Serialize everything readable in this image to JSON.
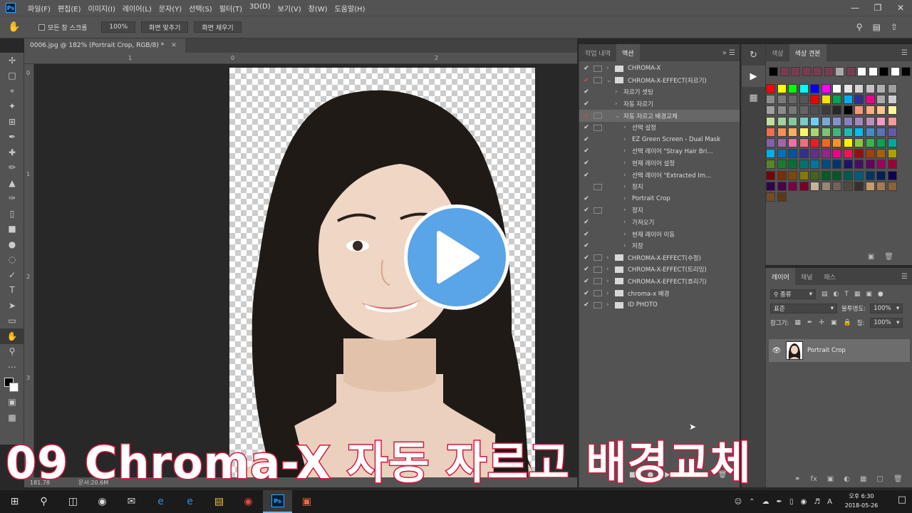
{
  "app": {
    "logo": "Ps"
  },
  "menu": [
    "파일(F)",
    "편집(E)",
    "이미지(I)",
    "레이어(L)",
    "문자(Y)",
    "선택(S)",
    "필터(T)",
    "3D(D)",
    "보기(V)",
    "창(W)",
    "도움말(H)"
  ],
  "options": {
    "scroll_all": "모든 창 스크롤",
    "zoom": "100%",
    "fit_screen": "화면 맞추기",
    "fill_screen": "화면 채우기"
  },
  "document": {
    "tab_title": "0006.jpg @ 182% (Portrait Crop, RGB/8) *",
    "zoom_status": "181.78",
    "doc_status": "문서:20.6M"
  },
  "rulers": {
    "h": [
      "0",
      "1",
      "2"
    ],
    "v": [
      "0",
      "1",
      "2",
      "3"
    ]
  },
  "actions": {
    "tabs": [
      "작업 내역",
      "액션"
    ],
    "rows": [
      {
        "label": "CHROMA-X",
        "checked": true,
        "red": false,
        "dialog": true,
        "depth": 0,
        "folder": true,
        "expanded": false
      },
      {
        "label": "CHROMA-X-EFFECT(자르기)",
        "checked": true,
        "red": true,
        "dialog": true,
        "depth": 0,
        "folder": true,
        "expanded": true
      },
      {
        "label": "자르기 셋팅",
        "checked": true,
        "red": false,
        "dialog": false,
        "depth": 1,
        "folder": false,
        "expanded": false
      },
      {
        "label": "자동 자르기",
        "checked": true,
        "red": false,
        "dialog": false,
        "depth": 1,
        "folder": false,
        "expanded": false
      },
      {
        "label": "자동 자르고 배경교체",
        "checked": true,
        "red": true,
        "dialog": true,
        "depth": 1,
        "folder": false,
        "expanded": true,
        "selected": true
      },
      {
        "label": "선택 설정",
        "checked": true,
        "red": false,
        "dialog": true,
        "depth": 2,
        "folder": false,
        "expanded": false
      },
      {
        "label": "EZ Green Screen - Dual Mask",
        "checked": true,
        "red": false,
        "dialog": false,
        "depth": 2,
        "folder": false,
        "expanded": false
      },
      {
        "label": "선택 레이어 \"Stray Hair Bri...",
        "checked": true,
        "red": false,
        "dialog": false,
        "depth": 2,
        "folder": false,
        "expanded": false
      },
      {
        "label": "현재 레이어 설정",
        "checked": true,
        "red": false,
        "dialog": false,
        "depth": 2,
        "folder": false,
        "expanded": false
      },
      {
        "label": "선택 레이어 \"Extracted Im...",
        "checked": true,
        "red": false,
        "dialog": false,
        "depth": 2,
        "folder": false,
        "expanded": false
      },
      {
        "label": "정지",
        "checked": false,
        "red": false,
        "dialog": true,
        "depth": 2,
        "folder": false,
        "expanded": false
      },
      {
        "label": "Portrait Crop",
        "checked": true,
        "red": false,
        "dialog": false,
        "depth": 2,
        "folder": false,
        "expanded": false
      },
      {
        "label": "정지",
        "checked": true,
        "red": false,
        "dialog": true,
        "depth": 2,
        "folder": false,
        "expanded": false
      },
      {
        "label": "가져오기",
        "checked": true,
        "red": false,
        "dialog": false,
        "depth": 2,
        "folder": false,
        "expanded": false
      },
      {
        "label": "현재 레이어 이동",
        "checked": true,
        "red": false,
        "dialog": false,
        "depth": 2,
        "folder": false,
        "expanded": false
      },
      {
        "label": "저장",
        "checked": true,
        "red": false,
        "dialog": false,
        "depth": 2,
        "folder": false,
        "expanded": false
      },
      {
        "label": "CHROMA-X-EFFECT(수정)",
        "checked": true,
        "red": false,
        "dialog": true,
        "depth": 0,
        "folder": true,
        "expanded": false
      },
      {
        "label": "CHROMA-X-EFFECT(트리밍)",
        "checked": true,
        "red": false,
        "dialog": true,
        "depth": 0,
        "folder": true,
        "expanded": false
      },
      {
        "label": "CHROMA-X-EFFECT(흐리기)",
        "checked": true,
        "red": false,
        "dialog": true,
        "depth": 0,
        "folder": true,
        "expanded": false
      },
      {
        "label": "chroma-x 배경",
        "checked": true,
        "red": false,
        "dialog": true,
        "depth": 0,
        "folder": true,
        "expanded": false
      },
      {
        "label": "ID PHOTO",
        "checked": true,
        "red": false,
        "dialog": true,
        "depth": 0,
        "folder": true,
        "expanded": false
      }
    ]
  },
  "swatches": {
    "tabs": [
      "색상",
      "색상 견본"
    ],
    "top_row": [
      "#000000",
      "#7a3a50",
      "#7a3a50",
      "#7a3a50",
      "#7a3a50",
      "#7a3a50",
      "#aaaaaa",
      "#7a3a50",
      "#ffffff",
      "#ffffff",
      "#000000",
      "#ffffff",
      "#000000"
    ],
    "grid": [
      [
        "#ff0000",
        "#ffff00",
        "#00ff00",
        "#00ffff",
        "#0000ff",
        "#ff00ff",
        "#ffffff",
        "#e6e6e6",
        "#d4d4d4",
        "#c2c2c2",
        "#b0b0b0",
        "#9e9e9e"
      ],
      [
        "#8c8c8c",
        "#7a7a7a",
        "#686868",
        "#565656",
        "#ee0000",
        "#ffe000",
        "#00a651",
        "#00aeef",
        "#2e3192",
        "#ec008c",
        "#aaaaaa",
        "#cccccc"
      ],
      [
        "#a0a0a0",
        "#8c8c8c",
        "#787878",
        "#646464",
        "#505050",
        "#3c3c3c",
        "#282828",
        "#000000",
        "#f7977a",
        "#f9ad81",
        "#fdc68a",
        "#fff79a"
      ],
      [
        "#c4df9b",
        "#a3d39c",
        "#82ca9c",
        "#7accc8",
        "#6dcff6",
        "#7da7d9",
        "#8393ca",
        "#8781bd",
        "#a187be",
        "#bc8dbf",
        "#f49ac2",
        "#f6989d"
      ],
      [
        "#f26c4f",
        "#f68e55",
        "#fbaf5c",
        "#fff467",
        "#acd372",
        "#7cc576",
        "#3bb878",
        "#1abbb4",
        "#00bff3",
        "#438ccb",
        "#5574b9",
        "#605ca8"
      ],
      [
        "#855fa8",
        "#a763a8",
        "#f06ea9",
        "#f26d7d",
        "#ed1c24",
        "#f26522",
        "#f7941d",
        "#fff200",
        "#8dc63f",
        "#39b54a",
        "#00a651",
        "#00a99d"
      ],
      [
        "#00aeef",
        "#0072bc",
        "#0054a6",
        "#2e3192",
        "#662d91",
        "#92278f",
        "#ec008c",
        "#ed145b",
        "#9e0b0f",
        "#a0410d",
        "#a36209",
        "#aba000"
      ],
      [
        "#598527",
        "#1a7b30",
        "#007236",
        "#00746b",
        "#0076a3",
        "#004b80",
        "#003471",
        "#1b1464",
        "#440e62",
        "#630460",
        "#9e005d",
        "#9e0039"
      ],
      [
        "#790000",
        "#7b2e00",
        "#7d4900",
        "#827b00",
        "#406618",
        "#005e20",
        "#005826",
        "#005952",
        "#005b7f",
        "#003663",
        "#002157",
        "#0d004c"
      ],
      [
        "#32004b",
        "#4b0049",
        "#7b0046",
        "#7a0026",
        "#c7b299",
        "#998675",
        "#736357",
        "#534741",
        "#37302d",
        "#c69c6d",
        "#a67c52",
        "#8c6239"
      ],
      [
        "#754c24",
        "#603913"
      ]
    ]
  },
  "layers": {
    "tabs": [
      "레이어",
      "채널",
      "패스"
    ],
    "filter_kind": "종류",
    "blend_mode": "표준",
    "opacity_label": "불투명도:",
    "opacity": "100%",
    "lock_label": "잠그기:",
    "fill_label": "칠:",
    "fill": "100%",
    "layer_name": "Portrait Crop"
  },
  "overlay": {
    "title": "09 Chroma-X 자동 자르고 배경교체"
  },
  "taskbar": {
    "time": "오후 6:30",
    "date": "2018-05-26",
    "ime": "A"
  }
}
